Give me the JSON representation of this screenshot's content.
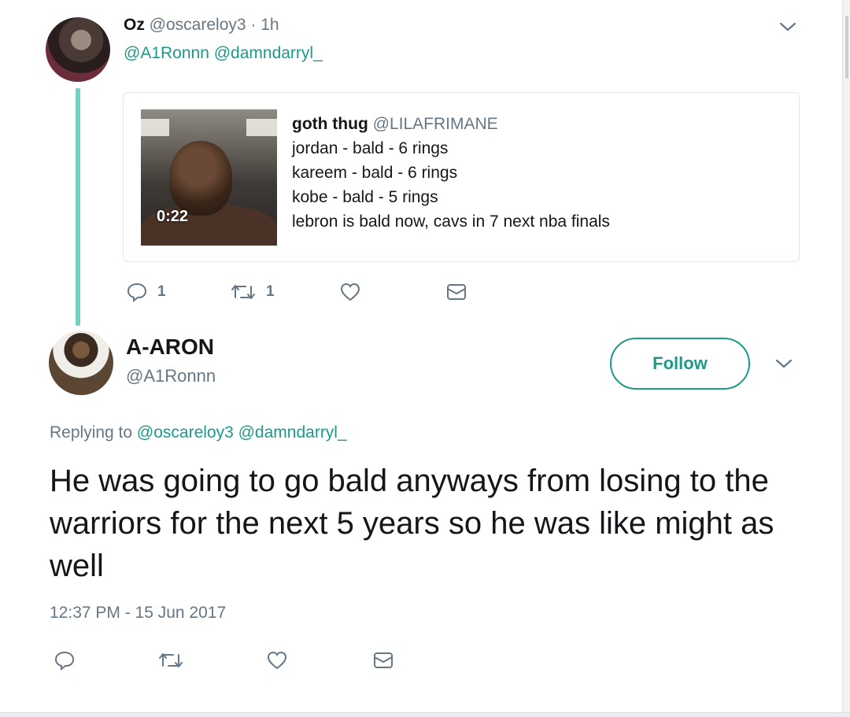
{
  "parent_tweet": {
    "author_name": "Oz",
    "author_meta": " @oscareloy3 · 1h",
    "mentions": "@A1Ronnn @damndarryl_",
    "quote": {
      "author_name": "goth thug",
      "author_handle": " @LILAFRIMANE",
      "lines": [
        "jordan - bald - 6 rings",
        "kareem - bald - 6 rings",
        "kobe - bald - 5 rings",
        "lebron is bald now, cavs in 7 next nba finals"
      ],
      "video_duration": "0:22"
    },
    "actions": {
      "reply_count": "1",
      "retweet_count": "1"
    }
  },
  "reply_tweet": {
    "author_name": "A-ARON",
    "author_handle": "@A1Ronnn",
    "follow_label": "Follow",
    "replying_prefix": "Replying to ",
    "replying_mentions": "@oscareloy3 @damndarryl_",
    "text": "He was going to go bald anyways from losing to the warriors for the next 5 years so he was like might as well",
    "timestamp": "12:37 PM - 15 Jun 2017"
  },
  "icons": {
    "reply": "reply-icon",
    "retweet": "retweet-icon",
    "like": "heart-icon",
    "dm": "envelope-icon",
    "more": "chevron-down-icon"
  },
  "colors": {
    "accent": "#1b9a8a",
    "thread_line": "#74d0c0",
    "muted": "#657786",
    "text": "#14171a"
  }
}
